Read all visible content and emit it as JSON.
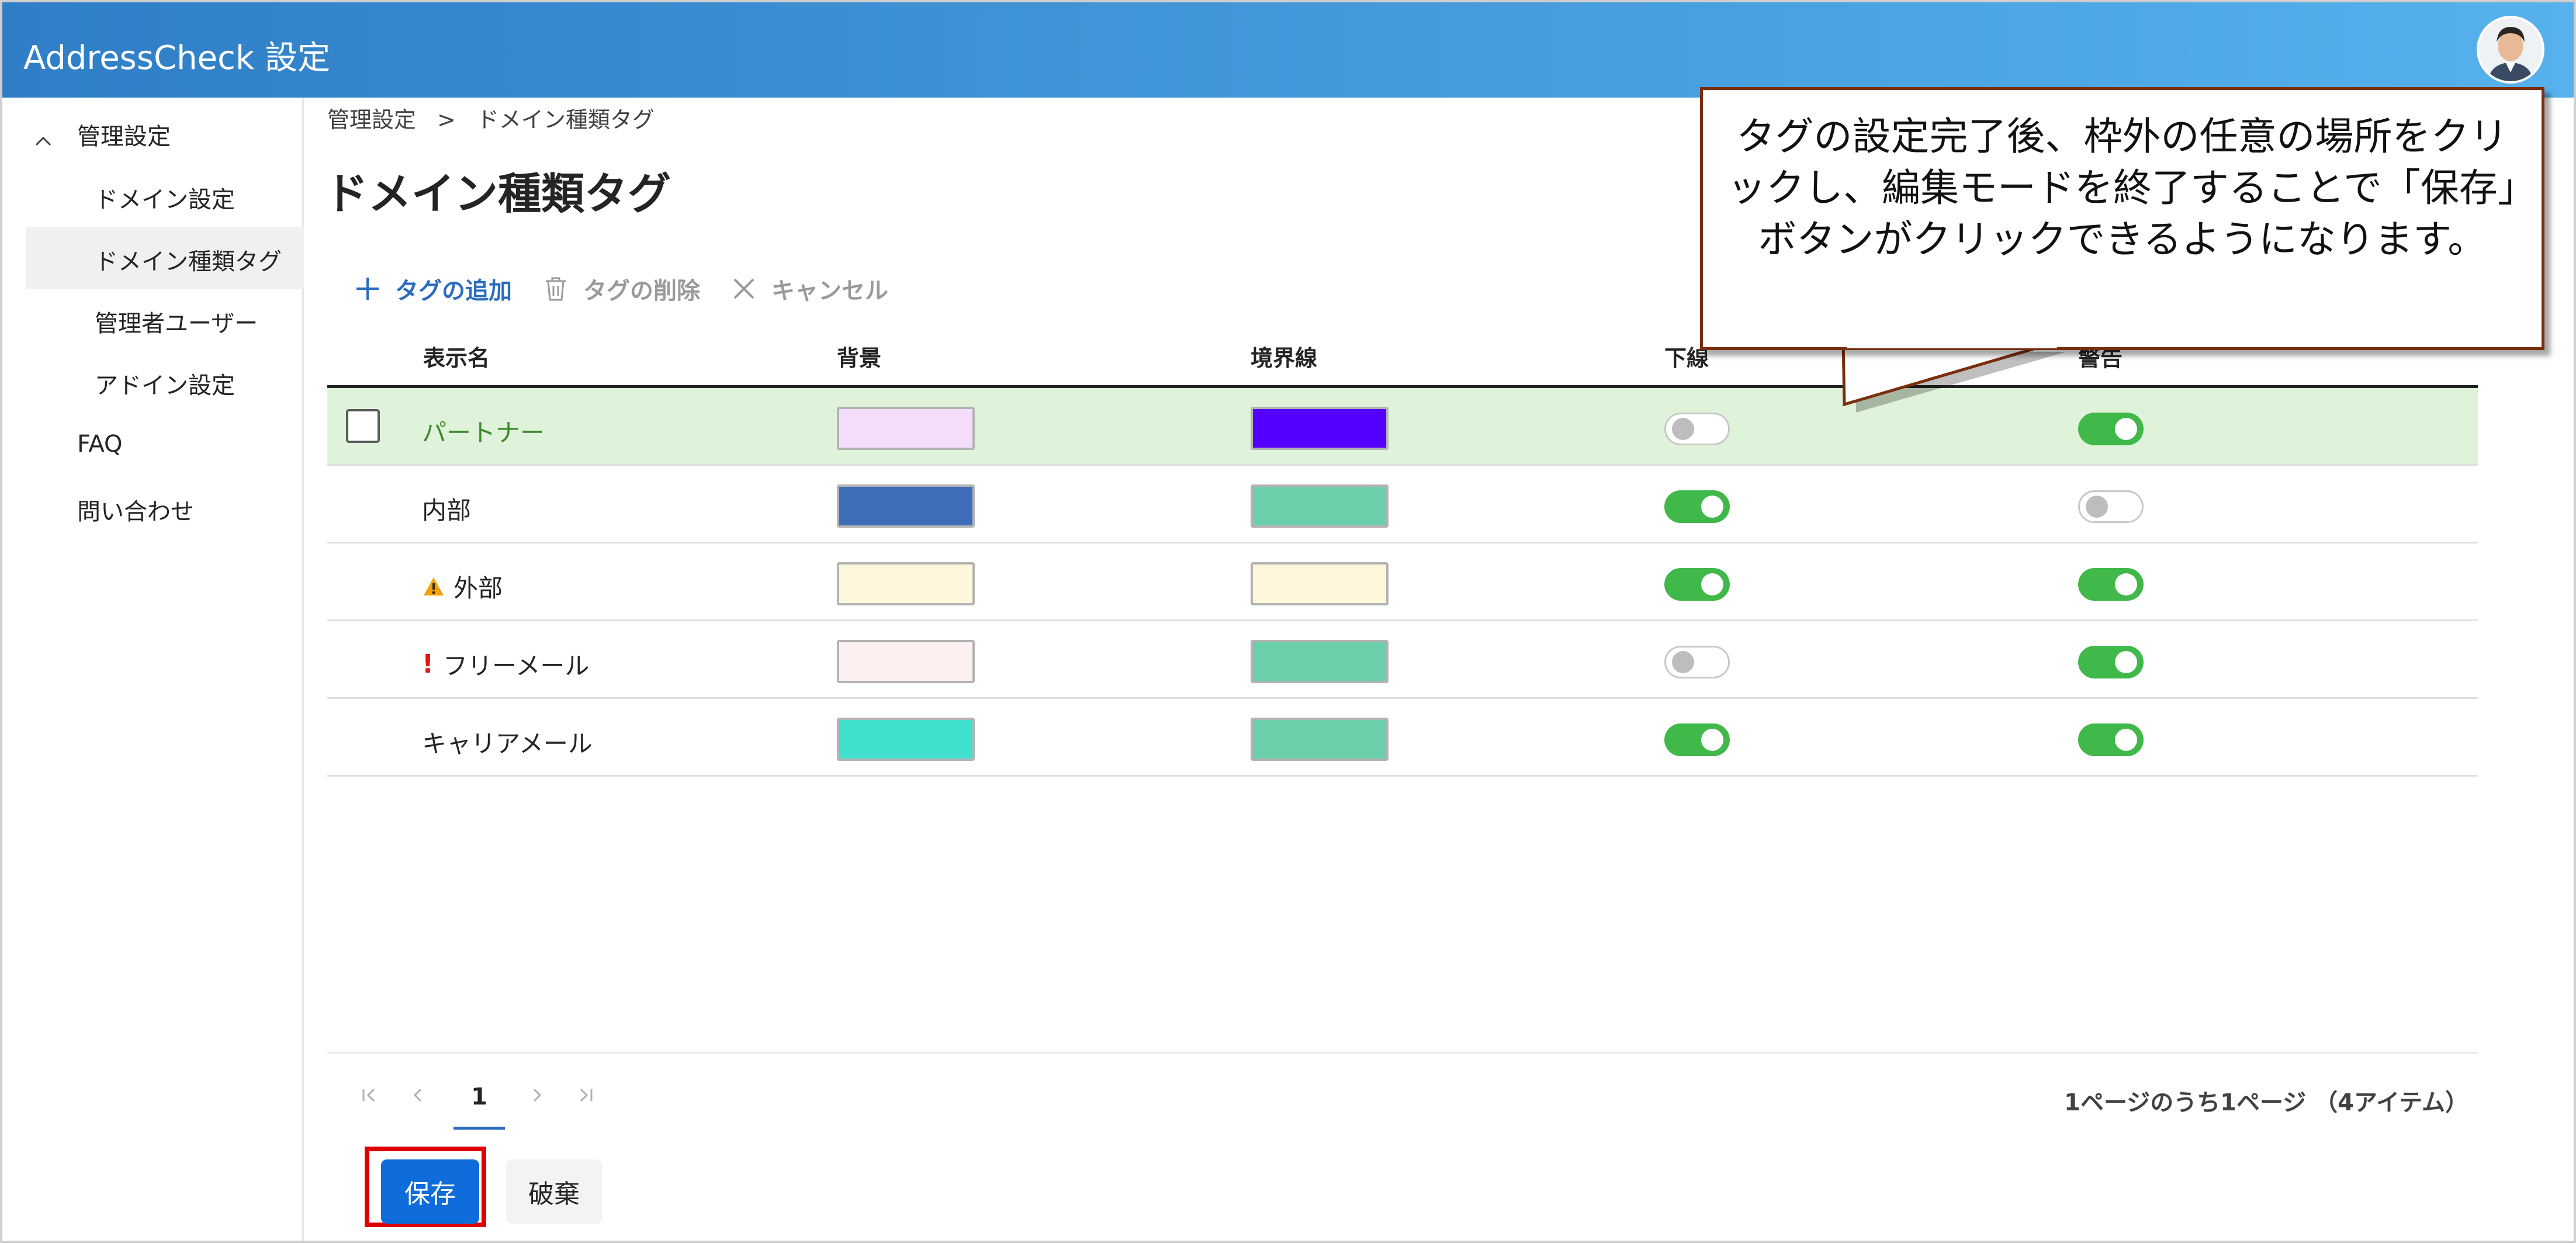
{
  "header": {
    "app_title": "AddressCheck 設定"
  },
  "sidebar": {
    "group_label": "管理設定",
    "items": [
      {
        "label": "ドメイン設定"
      },
      {
        "label": "ドメイン種類タグ"
      },
      {
        "label": "管理者ユーザー"
      },
      {
        "label": "アドイン設定"
      },
      {
        "label": "FAQ"
      },
      {
        "label": "問い合わせ"
      }
    ]
  },
  "breadcrumb": {
    "parent": "管理設定",
    "separator": ">",
    "current": "ドメイン種類タグ"
  },
  "page_title": "ドメイン種類タグ",
  "toolbar": {
    "add_label": "タグの追加",
    "delete_label": "タグの削除",
    "cancel_label": "キャンセル"
  },
  "table": {
    "columns": [
      "表示名",
      "背景",
      "境界線",
      "下線",
      "警告"
    ],
    "rows": [
      {
        "name": "パートナー",
        "icon": "",
        "background": "#f3ddfb",
        "border": "#5500ff",
        "underline": false,
        "warning": true,
        "selected": true
      },
      {
        "name": "内部",
        "icon": "",
        "background": "#3e6eb7",
        "border": "#6bcfa9",
        "underline": true,
        "warning": false,
        "selected": false
      },
      {
        "name": "外部",
        "icon": "warning-icon",
        "background": "#fff7dc",
        "border": "#fff7dc",
        "underline": true,
        "warning": true,
        "selected": false
      },
      {
        "name": "フリーメール",
        "icon": "exclamation-icon",
        "background": "#fdf0f0",
        "border": "#6bcfa9",
        "underline": false,
        "warning": true,
        "selected": false
      },
      {
        "name": "キャリアメール",
        "icon": "",
        "background": "#40e0cf",
        "border": "#6bcfa9",
        "underline": true,
        "warning": true,
        "selected": false
      }
    ]
  },
  "pager": {
    "current_page": "1",
    "info": "1ページのうち1ページ （4アイテム）"
  },
  "buttons": {
    "save_label": "保存",
    "discard_label": "破棄"
  },
  "callout": {
    "text": "タグの設定完了後、枠外の任意の場所をクリックし、編集モードを終了することで「保存」ボタンがクリックできるようになります。"
  },
  "colors": {
    "header_start": "#2f7ec7",
    "header_end": "#56b1ec",
    "accent": "#0f6cdb",
    "highlight_frame": "#e00000",
    "selected_row": "#dff3da"
  }
}
